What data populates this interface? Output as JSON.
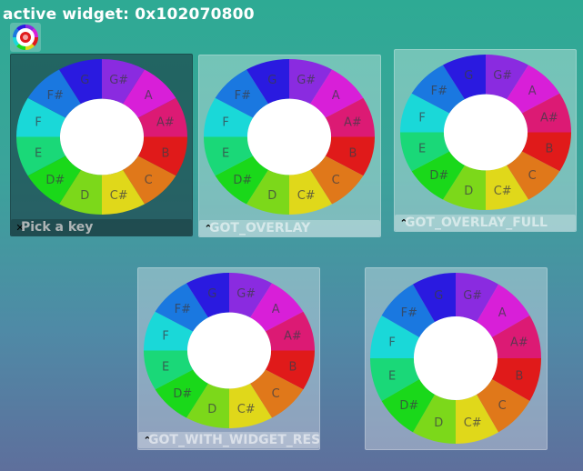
{
  "header": {
    "title": "active widget: 0x102070800"
  },
  "app_icon": {
    "name": "color-wheel-icon"
  },
  "wheel": {
    "notes": [
      "G#",
      "A",
      "A#",
      "B",
      "C",
      "C#",
      "D",
      "D#",
      "E",
      "F",
      "F#",
      "G"
    ],
    "colors": [
      "#8a2be0",
      "#d81fd8",
      "#dc1a74",
      "#e01a1a",
      "#e0781a",
      "#e0d81a",
      "#7cd81a",
      "#1ad81a",
      "#1ad878",
      "#1ad8d8",
      "#1a78e0",
      "#2a1ae0"
    ]
  },
  "panels": [
    {
      "id": "panel-pick-a-key",
      "label": "Pick a key",
      "button": "close-icon",
      "button_glyph": "✕",
      "active": true
    },
    {
      "id": "panel-got-overlay",
      "label": "GOT_OVERLAY",
      "button": "chevron-up-icon",
      "button_glyph": "⌃",
      "active": false
    },
    {
      "id": "panel-got-overlay-full",
      "label": "GOT_OVERLAY_FULL",
      "button": "chevron-up-icon",
      "button_glyph": "⌃",
      "active": false
    },
    {
      "id": "panel-got-with-widget-resize",
      "label": "GOT_WITH_WIDGET_RESIZE",
      "button": "chevron-up-icon",
      "button_glyph": "⌃",
      "active": false
    },
    {
      "id": "panel-plain",
      "label": "",
      "button": "",
      "button_glyph": "",
      "active": false
    }
  ]
}
